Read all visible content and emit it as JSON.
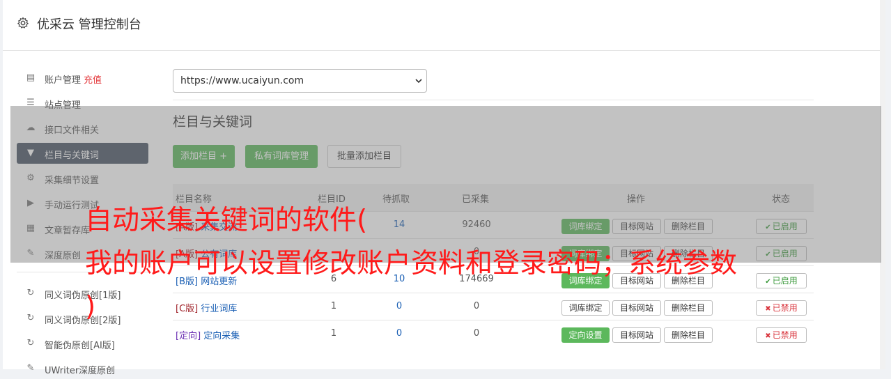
{
  "header": {
    "title": "优采云 管理控制台"
  },
  "sidebar": {
    "items": [
      {
        "label": "账户管理",
        "extra": "充值",
        "icon": "bar-chart-icon"
      },
      {
        "label": "站点管理",
        "icon": "server-icon"
      },
      {
        "label": "接口文件相关",
        "icon": "cloud-upload-icon"
      },
      {
        "label": "栏目与关键词",
        "icon": "filter-icon",
        "active": true
      },
      {
        "label": "采集细节设置",
        "icon": "cogs-icon"
      },
      {
        "label": "手动运行测试",
        "icon": "play-circle-icon"
      },
      {
        "label": "文章暂存库",
        "icon": "database-icon"
      },
      {
        "label": "深度原创",
        "icon": "edit-icon"
      }
    ],
    "items2": [
      {
        "label": "同义词伪原创[1版]",
        "icon": "refresh-icon"
      },
      {
        "label": "同义词伪原创[2版]",
        "icon": "refresh-icon"
      },
      {
        "label": "智能伪原创[AI版]",
        "icon": "refresh-icon"
      },
      {
        "label": "UWriter深度原创",
        "icon": "edit-icon"
      }
    ]
  },
  "main": {
    "site_select": {
      "value": "https://www.ucaiyun.com"
    },
    "section_title": "栏目与关键词",
    "buttons": {
      "add": "添加栏目 +",
      "private_lib": "私有词库管理",
      "batch_add": "批量添加栏目"
    },
    "table": {
      "headers": {
        "name": "栏目名称",
        "id": "栏目ID",
        "pending": "待抓取",
        "collected": "已采集",
        "ops": "操作",
        "status": "状态"
      },
      "rows": [
        {
          "ver": "[A版]",
          "name": "采集交流",
          "id": "",
          "pending": "14",
          "collected": "92460",
          "op1": "词库绑定",
          "op1_green": true,
          "op2": "目标网站",
          "op3": "删除栏目",
          "status": "已启用",
          "on": true
        },
        {
          "ver": "[A版]",
          "name": "公有词库",
          "id": "",
          "pending": "",
          "collected": "0",
          "op1": "词库绑定",
          "op1_green": true,
          "op2": "目标网站",
          "op3": "删除栏目",
          "status": "已启用",
          "on": true
        },
        {
          "ver": "[B版]",
          "name": "网站更新",
          "id": "6",
          "pending": "10",
          "collected": "174669",
          "op1": "词库绑定",
          "op1_green": true,
          "op2": "目标网站",
          "op3": "删除栏目",
          "status": "已启用",
          "on": true
        },
        {
          "ver": "[C版]",
          "name": "行业词库",
          "id": "1",
          "pending": "0",
          "collected": "0",
          "op1": "词库绑定",
          "op1_green": false,
          "op2": "目标网站",
          "op3": "删除栏目",
          "status": "已禁用",
          "on": false
        },
        {
          "ver": "[定向]",
          "name": "定向采集",
          "id": "1",
          "pending": "0",
          "collected": "0",
          "op1": "定向设置",
          "op1_green": true,
          "op2": "目标网站",
          "op3": "删除栏目",
          "status": "已禁用",
          "on": false
        }
      ]
    }
  },
  "overlay": {
    "line1": "自动采集关键词的软件(",
    "line2": "我的账户可以设置修改账户资料和登录密码；系统参数",
    "line3": ")"
  },
  "colors": {
    "accent_green": "#5cb85c",
    "active_nav": "#4a5564",
    "overlay_text": "#ff1a1a"
  }
}
